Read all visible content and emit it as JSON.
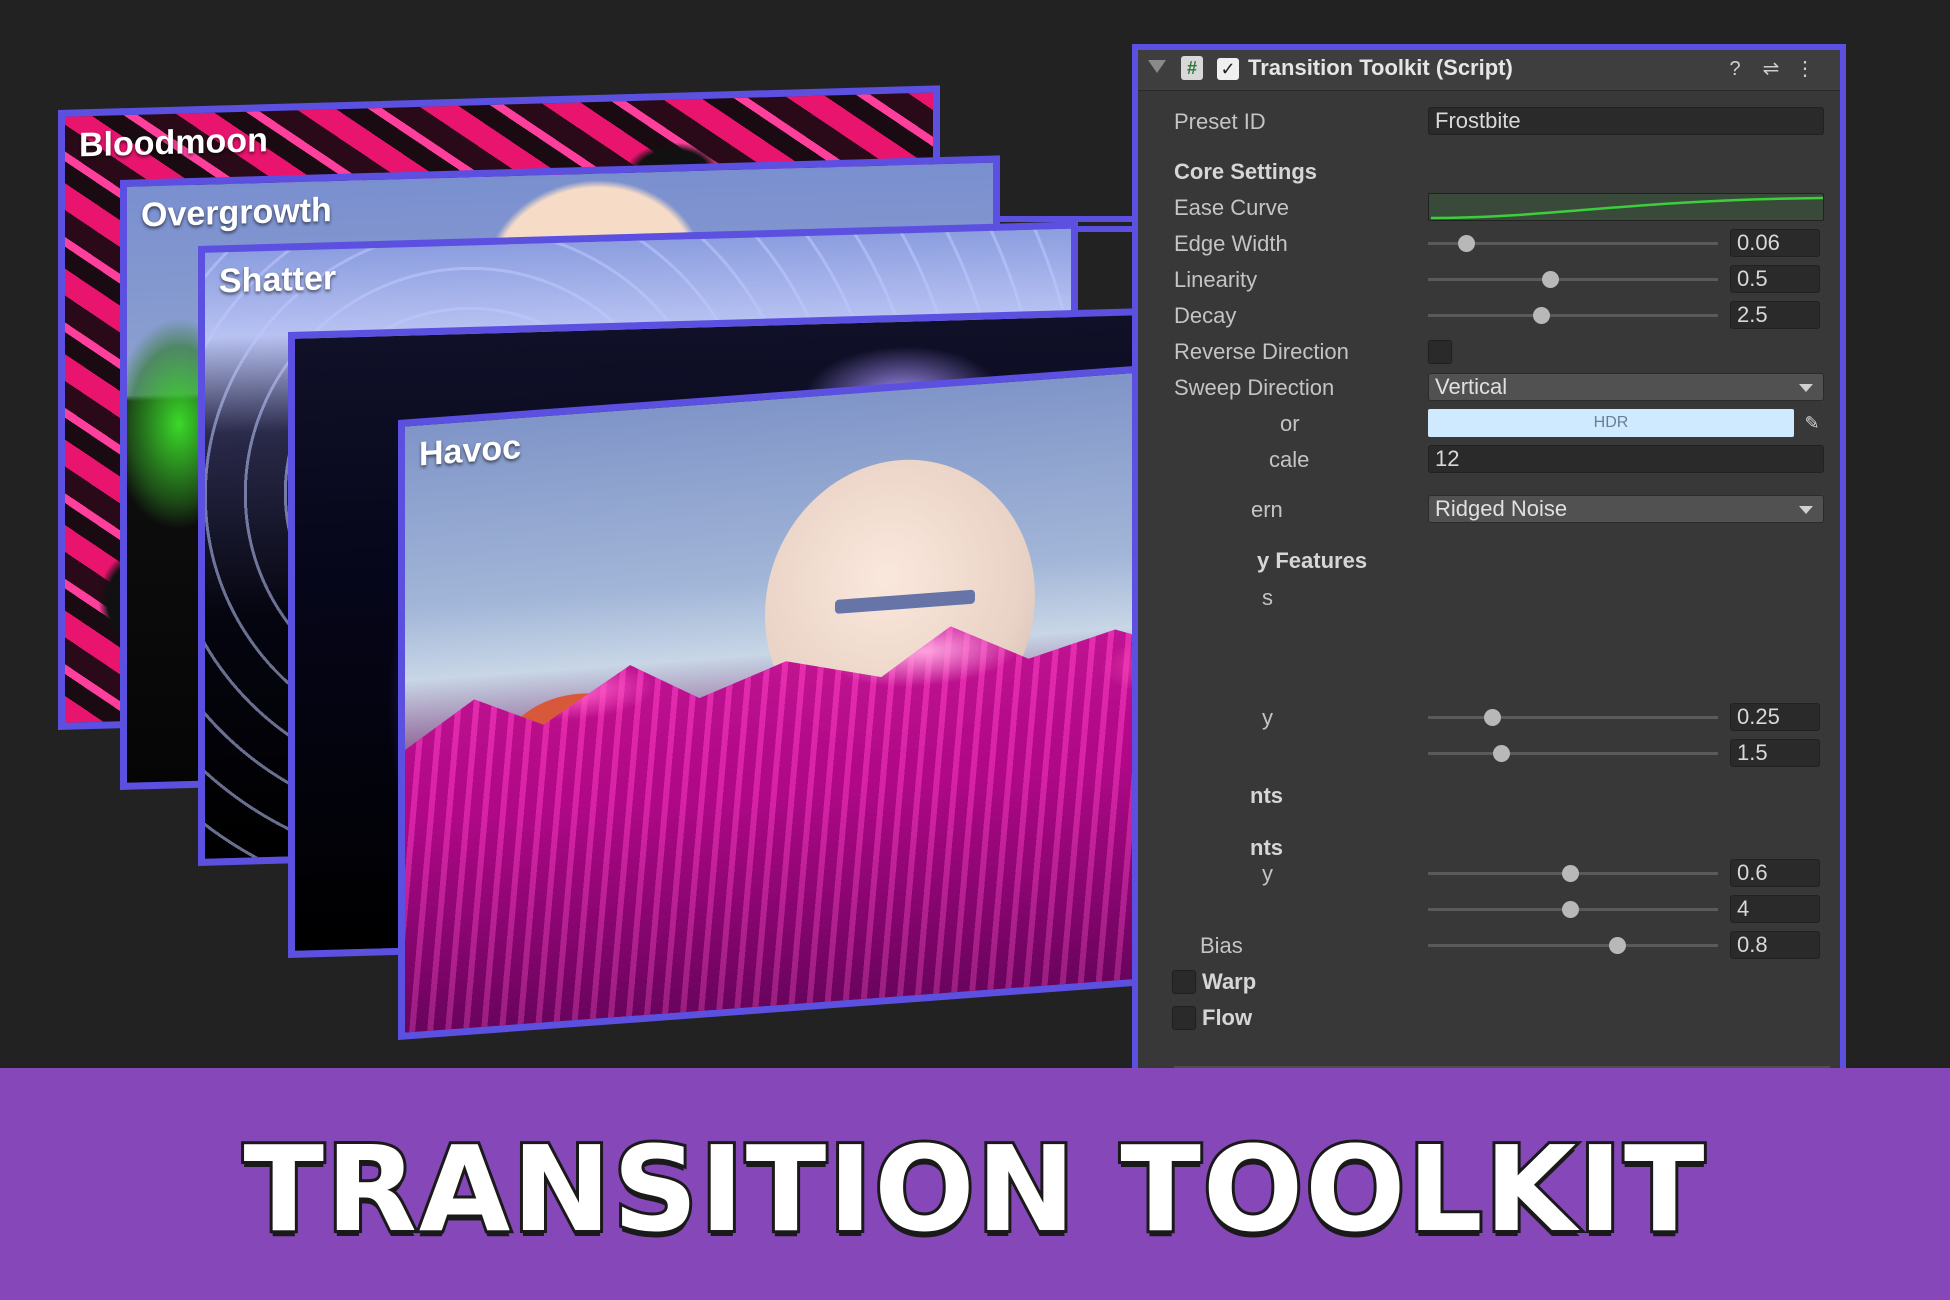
{
  "cards": {
    "bloodmoon": "Bloodmoon",
    "overgrowth": "Overgrowth",
    "shatter": "Shatter",
    "havoc": "Havoc"
  },
  "inspector": {
    "title": "Transition Toolkit (Script)",
    "preset_label": "Preset ID",
    "preset_value": "Frostbite",
    "core_header": "Core Settings",
    "ease_curve": "Ease Curve",
    "edge_width": {
      "label": "Edge Width",
      "value": "0.06",
      "fraction": 0.13
    },
    "linearity": {
      "label": "Linearity",
      "value": "0.5",
      "fraction": 0.42
    },
    "decay": {
      "label": "Decay",
      "value": "2.5",
      "fraction": 0.39
    },
    "reverse_direction": {
      "label": "Reverse Direction",
      "checked": false
    },
    "sweep_direction": {
      "label": "Sweep Direction",
      "value": "Vertical"
    },
    "color": {
      "label": "or",
      "hdr": "HDR",
      "hex": "#cfe9ff"
    },
    "scale": {
      "label": "cale",
      "value": "12"
    },
    "pattern": {
      "label": "ern",
      "value": "Ridged Noise"
    },
    "extra_header": "y Features",
    "frag_label": "s",
    "slider_a": {
      "label": "y",
      "value": "0.25",
      "fraction": 0.22
    },
    "slider_b": {
      "value": "1.5",
      "fraction": 0.25
    },
    "group_1": "nts",
    "group_2": "nts",
    "slider_c": {
      "label": "y",
      "value": "0.6",
      "fraction": 0.49
    },
    "slider_d": {
      "value": "4",
      "fraction": 0.49
    },
    "bias": {
      "label": "Bias",
      "value": "0.8",
      "fraction": 0.65
    },
    "warp": {
      "label": "Warp",
      "checked": false
    },
    "flow": {
      "label": "Flow",
      "checked": false
    }
  },
  "banner": {
    "title": "TRANSITION TOOLKIT"
  },
  "colors": {
    "accent": "#5b50e0",
    "banner": "#8648b8",
    "panel": "#383838"
  }
}
